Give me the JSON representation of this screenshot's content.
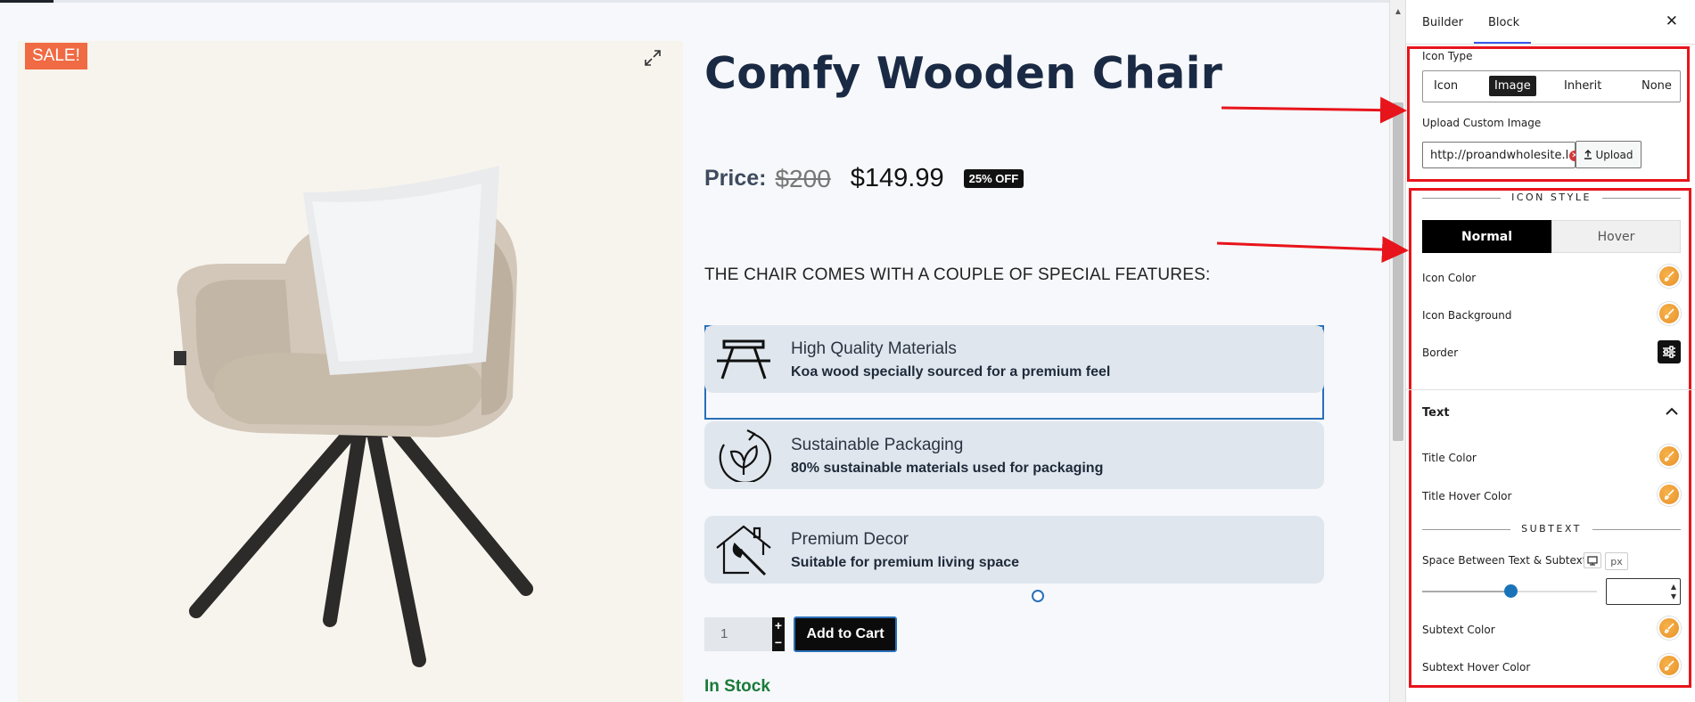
{
  "product": {
    "sale_badge": "SALE!",
    "title": "Comfy Wooden Chair",
    "price_label": "Price:",
    "price_old": "$200",
    "price_new": "$149.99",
    "discount_badge": "25% OFF",
    "features_heading": "THE CHAIR COMES WITH A COUPLE OF SPECIAL FEATURES:",
    "features": [
      {
        "title": "High Quality Materials",
        "subtitle": "Koa wood specially sourced for a premium feel",
        "icon": "picnic-table-icon"
      },
      {
        "title": "Sustainable Packaging",
        "subtitle": "80% sustainable materials used for packaging",
        "icon": "eco-leaf-icon"
      },
      {
        "title": "Premium Decor",
        "subtitle": "Suitable for premium living space",
        "icon": "home-paint-icon"
      }
    ],
    "quantity": "1",
    "qty_plus": "+",
    "qty_minus": "−",
    "add_to_cart": "Add to Cart",
    "stock_status": "In Stock"
  },
  "panel": {
    "tabs": [
      "Builder",
      "Block"
    ],
    "active_tab": "Block",
    "close": "✕",
    "icon_type_label": "Icon Type",
    "icon_type_options": [
      "Icon",
      "Image",
      "Inherit",
      "None"
    ],
    "icon_type_selected": "Image",
    "upload_label": "Upload Custom Image",
    "upload_url": "http://proandwholesite.l",
    "upload_button": "Upload",
    "icon_style_heading": "ICON STYLE",
    "state_tabs": [
      "Normal",
      "Hover"
    ],
    "state_selected": "Normal",
    "icon_color": "Icon Color",
    "icon_background": "Icon Background",
    "border": "Border",
    "text_section": "Text",
    "title_color": "Title Color",
    "title_hover_color": "Title Hover Color",
    "subtext_heading": "SUBTEXT",
    "space_between": "Space Between Text & Subtext",
    "unit": "px",
    "space_value": "",
    "subtext_color": "Subtext Color",
    "subtext_hover_color": "Subtext Hover Color"
  },
  "colors": {
    "sale": "#f06a43",
    "annotation": "#e8141b",
    "accent": "#3858e9",
    "swatch": "#e7912a"
  }
}
